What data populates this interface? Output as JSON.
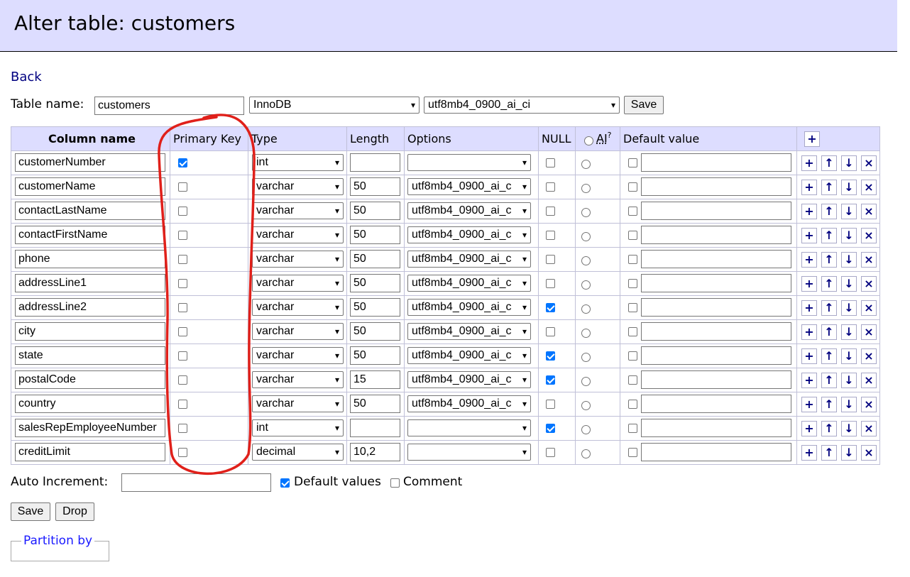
{
  "title": "Alter table: customers",
  "back_label": "Back",
  "table_name": {
    "label": "Table name:",
    "value": "customers",
    "engine": "InnoDB",
    "collation": "utf8mb4_0900_ai_ci",
    "save_label": "Save"
  },
  "columns_header": {
    "name": "Column name",
    "primary_key": "Primary Key",
    "type": "Type",
    "length": "Length",
    "options": "Options",
    "null": "NULL",
    "ai": "AI",
    "ai_help": "?",
    "default": "Default value",
    "add": "+"
  },
  "rows": [
    {
      "name": "customerNumber",
      "pk": true,
      "type": "int",
      "length": "",
      "options": "",
      "null": false
    },
    {
      "name": "customerName",
      "pk": false,
      "type": "varchar",
      "length": "50",
      "options": "utf8mb4_0900_ai_c",
      "null": false
    },
    {
      "name": "contactLastName",
      "pk": false,
      "type": "varchar",
      "length": "50",
      "options": "utf8mb4_0900_ai_c",
      "null": false
    },
    {
      "name": "contactFirstName",
      "pk": false,
      "type": "varchar",
      "length": "50",
      "options": "utf8mb4_0900_ai_c",
      "null": false
    },
    {
      "name": "phone",
      "pk": false,
      "type": "varchar",
      "length": "50",
      "options": "utf8mb4_0900_ai_c",
      "null": false
    },
    {
      "name": "addressLine1",
      "pk": false,
      "type": "varchar",
      "length": "50",
      "options": "utf8mb4_0900_ai_c",
      "null": false
    },
    {
      "name": "addressLine2",
      "pk": false,
      "type": "varchar",
      "length": "50",
      "options": "utf8mb4_0900_ai_c",
      "null": true
    },
    {
      "name": "city",
      "pk": false,
      "type": "varchar",
      "length": "50",
      "options": "utf8mb4_0900_ai_c",
      "null": false
    },
    {
      "name": "state",
      "pk": false,
      "type": "varchar",
      "length": "50",
      "options": "utf8mb4_0900_ai_c",
      "null": true
    },
    {
      "name": "postalCode",
      "pk": false,
      "type": "varchar",
      "length": "15",
      "options": "utf8mb4_0900_ai_c",
      "null": true
    },
    {
      "name": "country",
      "pk": false,
      "type": "varchar",
      "length": "50",
      "options": "utf8mb4_0900_ai_c",
      "null": false
    },
    {
      "name": "salesRepEmployeeNumber",
      "pk": false,
      "type": "int",
      "length": "",
      "options": "",
      "null": true
    },
    {
      "name": "creditLimit",
      "pk": false,
      "type": "decimal",
      "length": "10,2",
      "options": "",
      "null": false
    }
  ],
  "row_actions": {
    "add": "+",
    "up": "↑",
    "down": "↓",
    "remove": "×"
  },
  "auto_increment": {
    "label": "Auto Increment:",
    "value": ""
  },
  "default_values": {
    "label": "Default values",
    "checked": true
  },
  "comment": {
    "label": "Comment",
    "checked": false
  },
  "save_label": "Save",
  "drop_label": "Drop",
  "partition_label": "Partition by",
  "colors": {
    "header_bg": "#ddf",
    "link": "#000080",
    "check": "#0075ff",
    "annotation": "#e0201a"
  }
}
